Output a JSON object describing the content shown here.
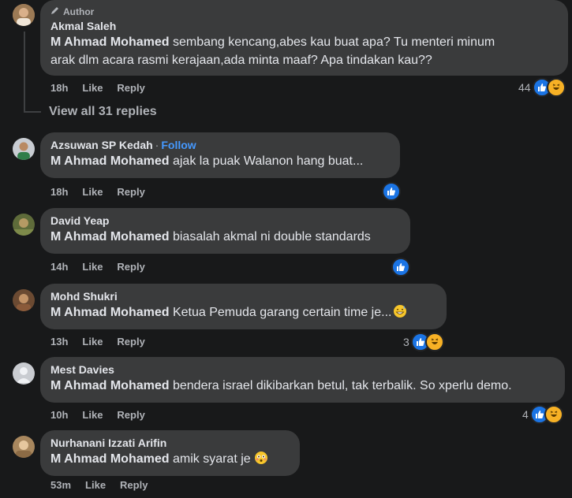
{
  "comments": [
    {
      "name": "Akmal Saleh",
      "badge": "Author",
      "mention": "M Ahmad Mohamed",
      "text_line1": " sembang kencang,abes kau buat apa? Tu menteri minum",
      "text_line2": "arak dlm acara rasmi kerajaan,ada minta maaf? Apa tindakan kau??",
      "time": "18h",
      "like": "Like",
      "reply": "Reply",
      "reaction_count": "44"
    },
    {
      "name": "Azsuwan SP Kedah",
      "follow": "Follow",
      "mention": "M Ahmad Mohamed",
      "text": " ajak la puak Walanon hang buat...",
      "time": "18h",
      "like": "Like",
      "reply": "Reply"
    },
    {
      "name": "David Yeap",
      "mention": "M Ahmad Mohamed",
      "text": " biasalah akmal ni double standards",
      "time": "14h",
      "like": "Like",
      "reply": "Reply"
    },
    {
      "name": "Mohd Shukri",
      "mention": "M Ahmad Mohamed",
      "text": " Ketua Pemuda garang certain time je...",
      "time": "13h",
      "like": "Like",
      "reply": "Reply",
      "reaction_count": "3"
    },
    {
      "name": "Mest Davies",
      "mention": "M Ahmad Mohamed",
      "text": " bendera israel dikibarkan betul, tak terbalik. So xperlu demo.",
      "time": "10h",
      "like": "Like",
      "reply": "Reply",
      "reaction_count": "4"
    },
    {
      "name": "Nurhanani Izzati Arifin",
      "mention": "M Ahmad Mohamed",
      "text": " amik syarat je ",
      "time": "53m",
      "like": "Like",
      "reply": "Reply"
    }
  ],
  "view_replies": "View all 31 replies",
  "colors": {
    "background": "#18191a",
    "bubble": "#3a3b3c",
    "text": "#e4e6eb",
    "muted": "#b0b3b8",
    "follow": "#4599ff",
    "like_reaction": "#1b74e4",
    "haha_reaction": "#f7b125"
  },
  "icons": [
    "pencil-icon",
    "like-reaction-icon",
    "haha-reaction-icon",
    "grin-sweat-emoji-icon",
    "flushed-emoji-icon"
  ]
}
